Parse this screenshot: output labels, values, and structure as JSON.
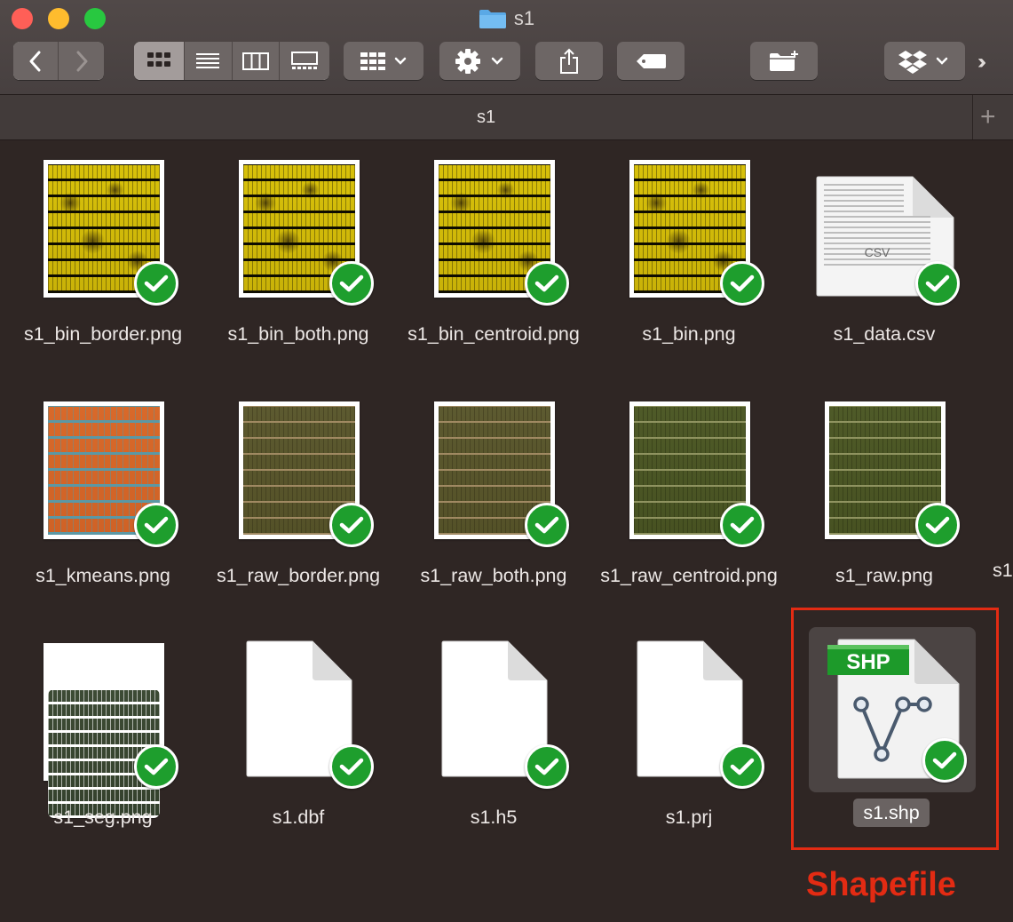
{
  "window": {
    "title": "s1"
  },
  "toolbar": {
    "icons": {
      "back": "chevron-left-icon",
      "forward": "chevron-right-icon",
      "view_icons": "grid-view-icon",
      "view_list": "list-view-icon",
      "view_columns": "column-view-icon",
      "view_gallery": "gallery-view-icon",
      "group": "group-grid-icon",
      "action": "gear-icon",
      "share": "share-icon",
      "tags": "tag-icon",
      "new_folder": "new-folder-icon",
      "dropbox": "dropbox-icon",
      "overflow": "double-chevron-right-icon"
    },
    "active_view": "icons"
  },
  "pathbar": {
    "label": "s1"
  },
  "files": {
    "row1": [
      {
        "name": "s1_bin_border.png",
        "kind": "binary-yellow"
      },
      {
        "name": "s1_bin_both.png",
        "kind": "binary-yellow"
      },
      {
        "name": "s1_bin_centroid.png",
        "kind": "binary-yellow"
      },
      {
        "name": "s1_bin.png",
        "kind": "binary-yellow"
      },
      {
        "name": "s1_data.csv",
        "kind": "csv",
        "badge": "CSV"
      }
    ],
    "row2": [
      {
        "name": "s1_kmeans.png",
        "kind": "kmeans"
      },
      {
        "name": "s1_raw_border.png",
        "kind": "raw-brown"
      },
      {
        "name": "s1_raw_both.png",
        "kind": "raw-brown"
      },
      {
        "name": "s1_raw_centroid.png",
        "kind": "raw-green"
      },
      {
        "name": "s1_raw.png",
        "kind": "raw-green"
      }
    ],
    "row3": [
      {
        "name": "s1_seg.png",
        "kind": "seg"
      },
      {
        "name": "s1.dbf",
        "kind": "blank"
      },
      {
        "name": "s1.h5",
        "kind": "blank"
      },
      {
        "name": "s1.prj",
        "kind": "blank"
      },
      {
        "name": "s1.shp",
        "kind": "shp",
        "badge": "SHP",
        "selected": true
      }
    ],
    "partial_next": "s1"
  },
  "annotation": {
    "label": "Shapefile",
    "color": "#e32b13"
  },
  "colors": {
    "sync_check": "#1e9e2d",
    "background": "#2f2624"
  }
}
